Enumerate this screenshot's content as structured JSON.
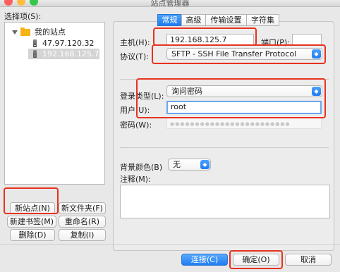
{
  "window": {
    "title": "站点管理器"
  },
  "left": {
    "select_label": "选择项(S):",
    "tree": {
      "root": "我的站点",
      "items": [
        "47.97.120.32",
        "192.168.125.7"
      ]
    },
    "buttons": {
      "new_site": "新站点(N)",
      "new_folder": "新文件夹(F)",
      "new_bookmark": "新建书签(M)",
      "rename": "重命名(R)",
      "delete": "删除(D)",
      "copy": "复制(I)"
    }
  },
  "tabs": [
    "常规",
    "高级",
    "传输设置",
    "字符集"
  ],
  "general": {
    "host_label": "主机(H):",
    "host_value": "192.168.125.7",
    "port_label": "端口(P):",
    "port_value": "",
    "protocol_label": "协议(T):",
    "protocol_value": "SFTP - SSH File Transfer Protocol",
    "logon_type_label": "登录类型(L):",
    "logon_type_value": "询问密码",
    "user_label": "用户(U):",
    "user_value": "root",
    "password_label": "密码(W):",
    "password_dots": "●●●●●●●●●●●●●●●●●●●●●●●●",
    "bg_color_label": "背景颜色(B)",
    "bg_color_value": "无",
    "comments_label": "注释(M):"
  },
  "footer": {
    "connect": "连接(C)",
    "ok": "确定(O)",
    "cancel": "取消"
  },
  "colors": {
    "accent": "#1f7cf2",
    "highlight": "#e8321e"
  }
}
